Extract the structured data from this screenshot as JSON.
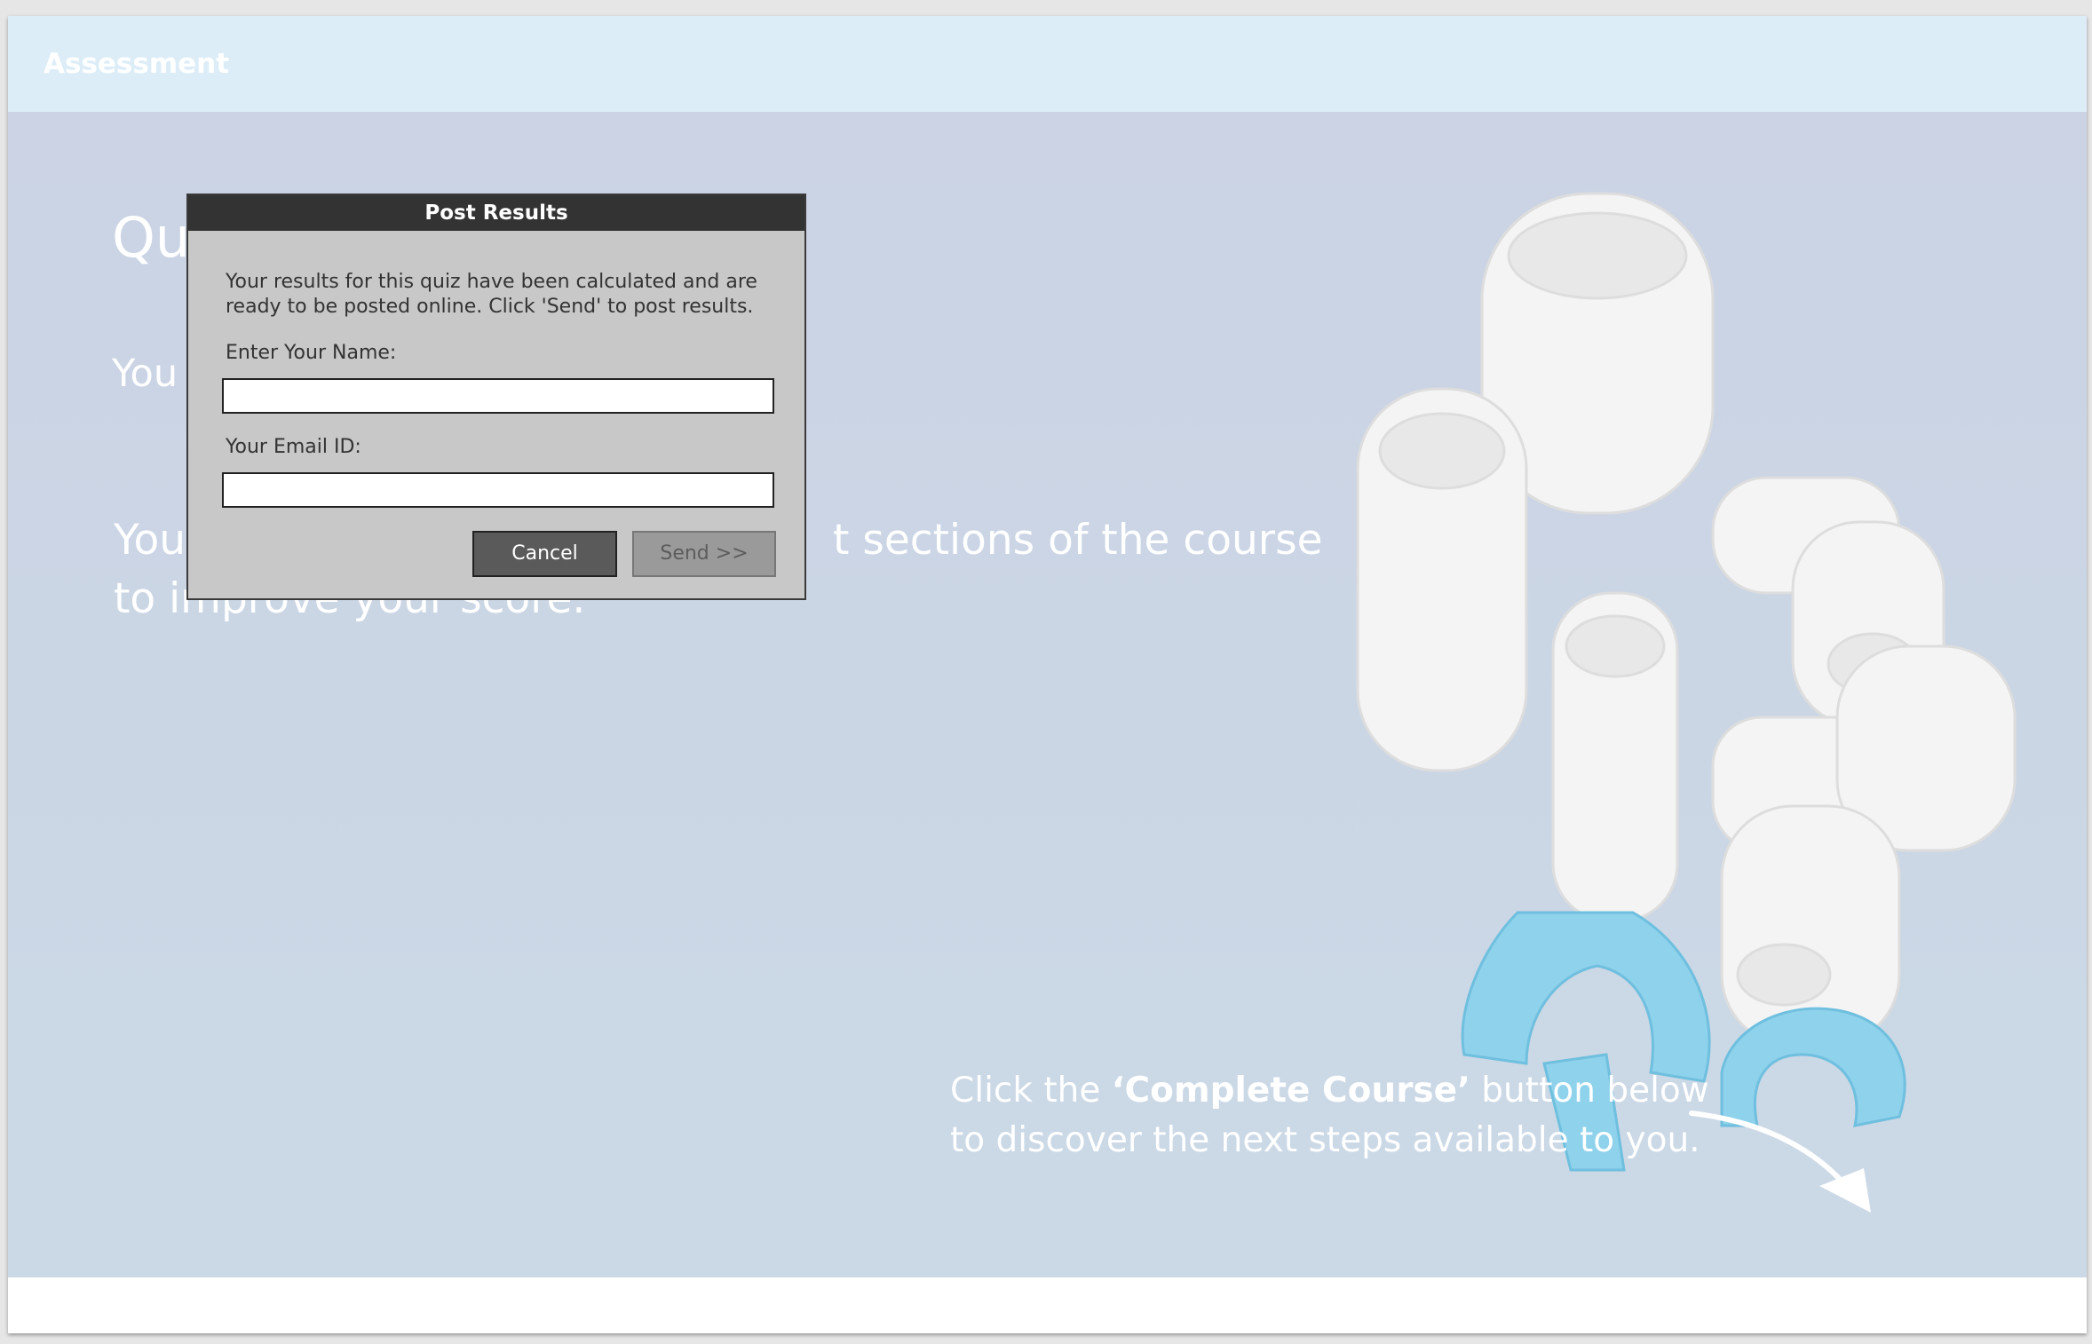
{
  "header": {
    "title": "Assessment"
  },
  "background": {
    "heading": "Qu",
    "line1": "You",
    "para_left": "You",
    "para_right": "t sections of the course",
    "para_line2": "to improve your score."
  },
  "hint": {
    "prefix": "Click the ",
    "emphasis": "‘Complete Course’",
    "suffix": " button below",
    "line2": "to discover the next steps available to you."
  },
  "dialog": {
    "title": "Post Results",
    "message": "Your results for this quiz have been calculated and are ready to be posted online. Click 'Send' to post results.",
    "name_label": "Enter Your Name:",
    "name_value": "",
    "email_label": "Your Email ID:",
    "email_value": "",
    "cancel_label": "Cancel",
    "send_label": "Send >>"
  },
  "icons": {
    "product": "pipe-fittings-image",
    "arrow": "curved-arrow-icon"
  },
  "colors": {
    "header_bg": "#dcedf8",
    "content_bg": "#cbd5e6",
    "dialog_title_bg": "#333333",
    "dialog_bg": "#c8c8c8"
  }
}
